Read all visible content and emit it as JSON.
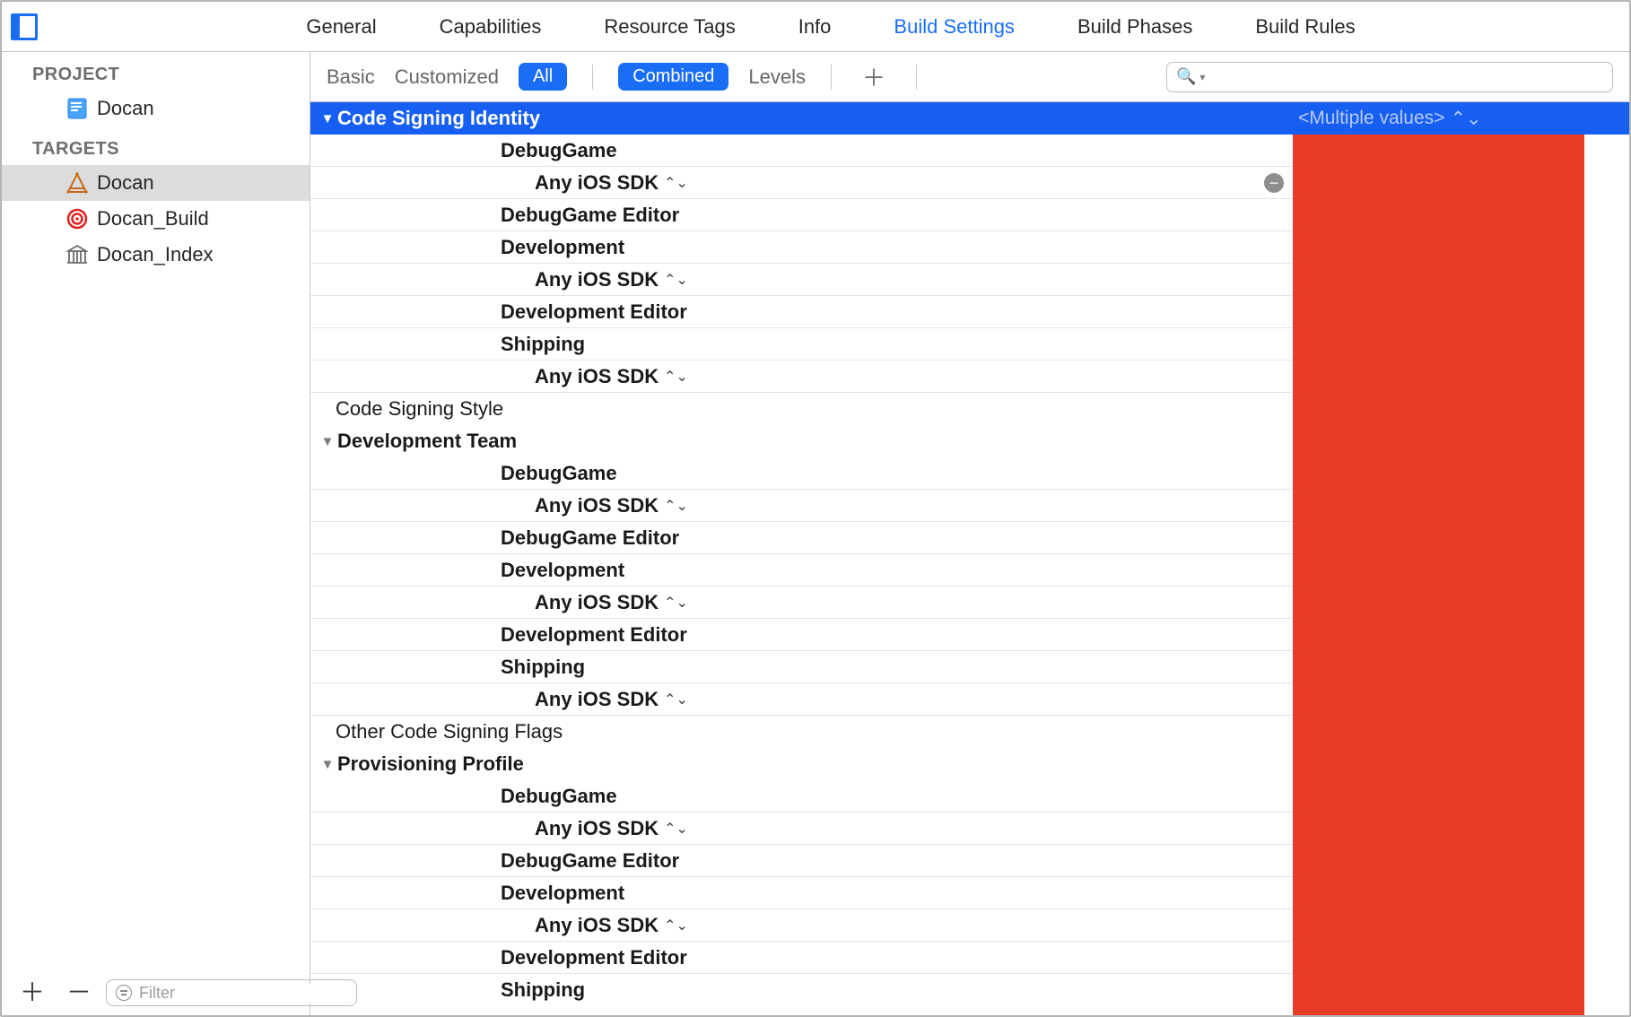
{
  "top_tabs": {
    "general": "General",
    "capabilities": "Capabilities",
    "resource_tags": "Resource Tags",
    "info": "Info",
    "build_settings": "Build Settings",
    "build_phases": "Build Phases",
    "build_rules": "Build Rules"
  },
  "sidebar": {
    "project_header": "PROJECT",
    "project_name": "Docan",
    "targets_header": "TARGETS",
    "targets": [
      {
        "name": "Docan"
      },
      {
        "name": "Docan_Build"
      },
      {
        "name": "Docan_Index"
      }
    ],
    "filter_placeholder": "Filter"
  },
  "toolbar": {
    "basic": "Basic",
    "customized": "Customized",
    "all": "All",
    "combined": "Combined",
    "levels": "Levels",
    "search_placeholder": ""
  },
  "header_row": {
    "title": "Code Signing Identity",
    "value": "<Multiple values>"
  },
  "settings": {
    "code_signing_style": "Code Signing Style",
    "development_team": "Development Team",
    "other_flags": "Other Code Signing Flags",
    "provisioning_profile": "Provisioning Profile"
  },
  "configs": {
    "debug_game": "DebugGame",
    "debug_game_editor": "DebugGame Editor",
    "development": "Development",
    "development_editor": "Development Editor",
    "shipping": "Shipping",
    "any_ios_sdk": "Any iOS SDK"
  }
}
